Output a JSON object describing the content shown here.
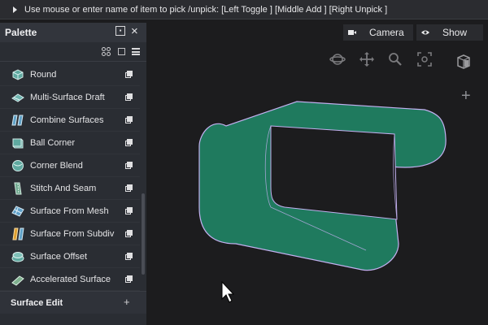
{
  "status_bar": {
    "text": "Use mouse or enter name of item to pick /unpick: [Left Toggle ] [Middle Add ] [Right Unpick ]"
  },
  "palette": {
    "title": "Palette",
    "items": [
      {
        "label": "Round",
        "icon": "round-icon"
      },
      {
        "label": "Multi-Surface Draft",
        "icon": "draft-icon"
      },
      {
        "label": "Combine Surfaces",
        "icon": "combine-icon"
      },
      {
        "label": "Ball Corner",
        "icon": "ball-corner-icon"
      },
      {
        "label": "Corner Blend",
        "icon": "corner-blend-icon"
      },
      {
        "label": "Stitch And Seam",
        "icon": "stitch-icon"
      },
      {
        "label": "Surface From Mesh",
        "icon": "mesh-icon"
      },
      {
        "label": "Surface From Subdiv",
        "icon": "subdiv-icon"
      },
      {
        "label": "Surface Offset",
        "icon": "offset-icon"
      },
      {
        "label": "Accelerated Surface",
        "icon": "accelerated-icon"
      }
    ],
    "section": {
      "label": "Surface Edit"
    }
  },
  "viewport": {
    "camera_label": "Camera",
    "show_label": "Show"
  },
  "colors": {
    "surface": "#1f7a5e",
    "edge": "#c3b0f0",
    "background": "#1c1c1e"
  }
}
